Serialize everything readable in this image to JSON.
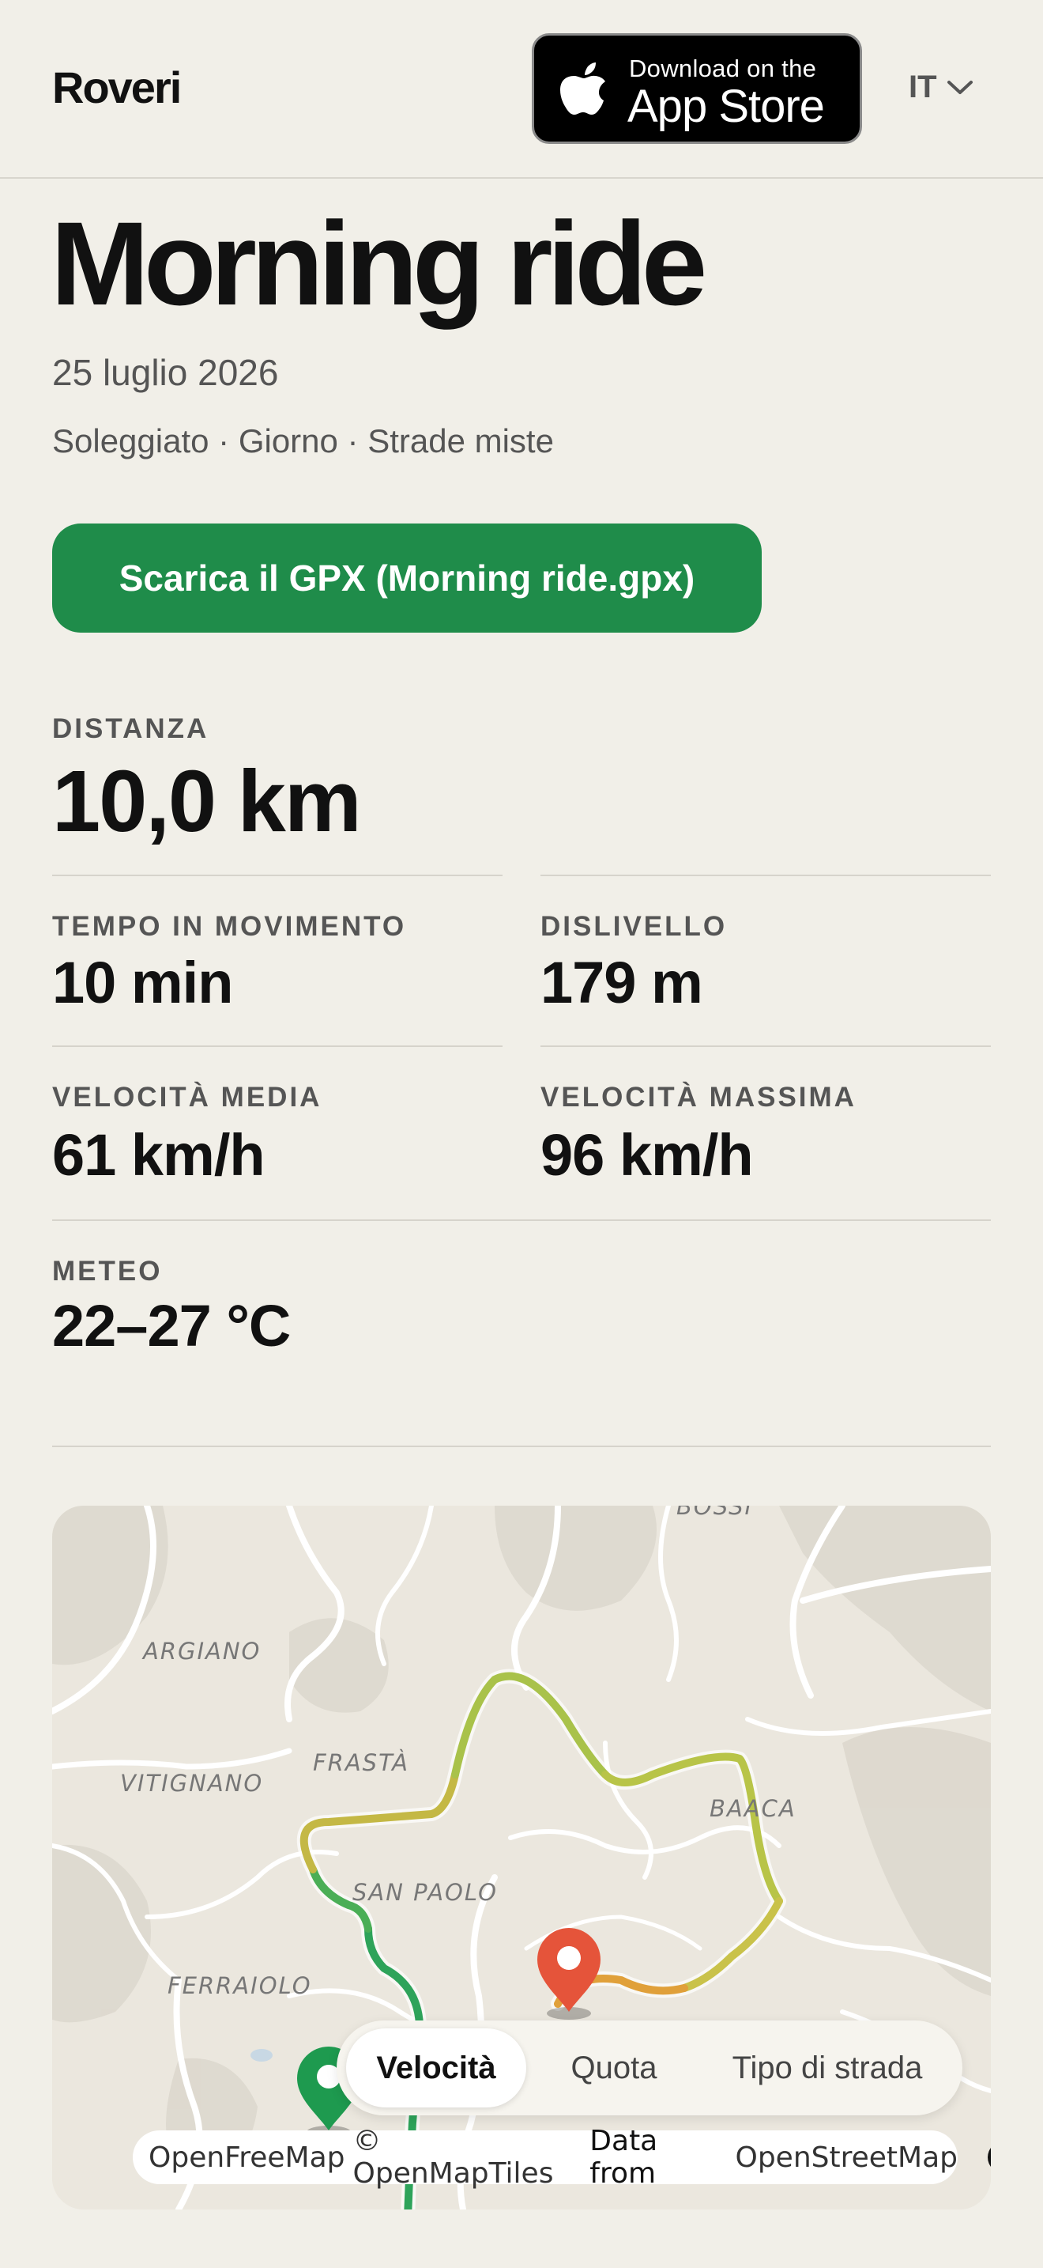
{
  "header": {
    "brand": "Roveri",
    "appstore_small": "Download on the",
    "appstore_big": "App Store",
    "language": "IT"
  },
  "ride": {
    "title": "Morning ride",
    "date": "25 luglio 2026",
    "tags": "Soleggiato · Giorno · Strade miste",
    "download_label": "Scarica il GPX (Morning ride.gpx)"
  },
  "stats": {
    "distance": {
      "label": "DISTANZA",
      "value": "10,0 km"
    },
    "moving_time": {
      "label": "TEMPO IN MOVIMENTO",
      "value": "10 min"
    },
    "elevation": {
      "label": "DISLIVELLO",
      "value": "179 m"
    },
    "avg_speed": {
      "label": "VELOCITÀ MEDIA",
      "value": "61 km/h"
    },
    "max_speed": {
      "label": "VELOCITÀ MASSIMA",
      "value": "96 km/h"
    },
    "weather": {
      "label": "METEO",
      "value": "22–27 °C"
    }
  },
  "map": {
    "places": [
      "ARGIANO",
      "VITIGNANO",
      "FRASTÀ",
      "BAACA",
      "SAN PAOLO",
      "FERRAIOLO",
      "BOSSI"
    ],
    "modes": [
      "Velocità",
      "Quota",
      "Tipo di strada"
    ],
    "active_mode": "Velocità",
    "attribution": {
      "a": "OpenFreeMap",
      "b": "© OpenMapTiles",
      "c": "Data from",
      "d": "OpenStreetMap"
    },
    "colors": {
      "start_pin": "#1e9a4f",
      "end_pin": "#e5543a",
      "slow": "#2ea35a",
      "fast": "#e0a03a"
    }
  }
}
